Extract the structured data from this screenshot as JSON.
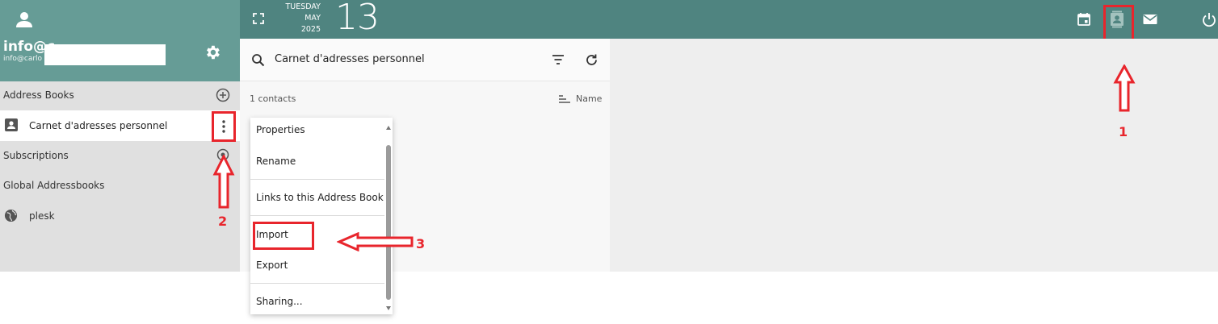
{
  "user": {
    "name": "info@c",
    "email": "info@carlo"
  },
  "sidebar": {
    "address_books_label": "Address Books",
    "personal_book_label": "Carnet d'adresses personnel",
    "subscriptions_label": "Subscriptions",
    "global_label": "Global Addressbooks",
    "global_items": [
      "plesk"
    ]
  },
  "topbar": {
    "weekday": "TUESDAY",
    "month": "MAY",
    "year": "2025",
    "day": "13"
  },
  "list": {
    "search_title": "Carnet d'adresses personnel",
    "count_label": "1 contacts",
    "sort_label": "Name"
  },
  "menu": {
    "items": [
      "Properties",
      "Rename",
      "Links to this Address Book",
      "Import",
      "Export",
      "Sharing..."
    ]
  },
  "annotations": {
    "one": "1",
    "two": "2",
    "three": "3"
  },
  "icons": {
    "avatar": "person-icon",
    "gear": "gear-icon",
    "calendar": "calendar-icon",
    "contacts": "contacts-icon",
    "mail": "mail-icon",
    "power": "power-icon"
  },
  "colors": {
    "sidebar_header": "#669c96",
    "topbar": "#4f8480",
    "annotation": "#e8252c"
  }
}
